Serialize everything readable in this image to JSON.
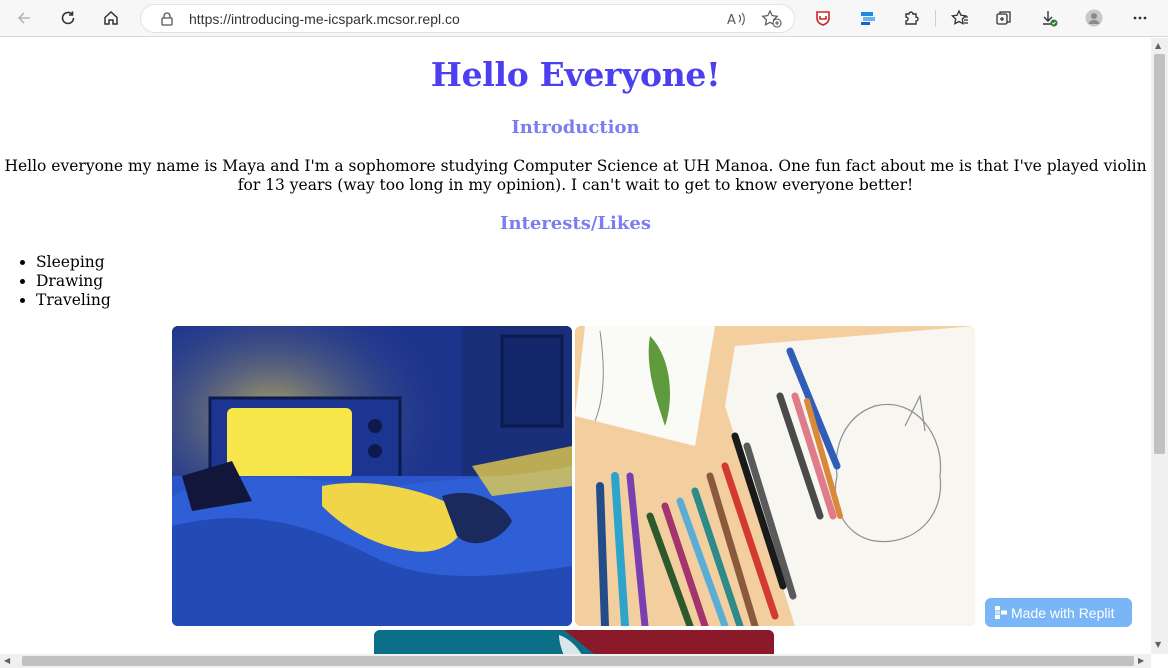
{
  "browser": {
    "url": "https://introducing-me-icspark.mcsor.repl.co"
  },
  "page": {
    "title": "Hello Everyone!",
    "intro_heading": "Introduction",
    "intro_text": "Hello everyone my name is Maya and I'm a sophomore studying Computer Science at UH Manoa. One fun fact about me is that I've played violin for 13 years (way too long in my opinion). I can't wait to get to know everyone better!",
    "interests_heading": "Interests/Likes",
    "interests": [
      "Sleeping",
      "Drawing",
      "Traveling"
    ]
  },
  "badge": {
    "label": "Made with Replit"
  },
  "colors": {
    "title": "#4b3ff0",
    "subheading": "#7b7ef0",
    "badge_bg": "#7ab6f7"
  }
}
